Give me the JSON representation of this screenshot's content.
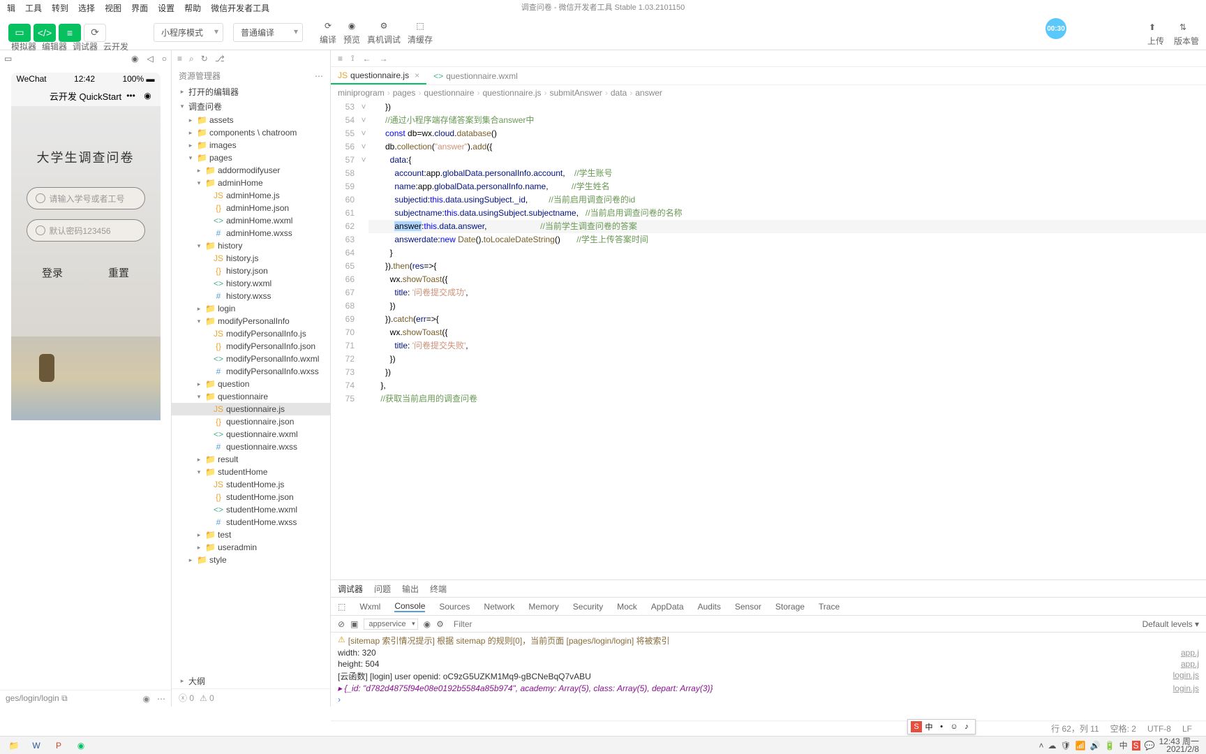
{
  "menubar": [
    "辑",
    "工具",
    "转到",
    "选择",
    "视图",
    "界面",
    "设置",
    "帮助",
    "微信开发者工具"
  ],
  "titlebar": "调查问卷 - 微信开发者工具 Stable 1.03.2101150",
  "toolbar": {
    "group_labels": [
      "模拟器",
      "编辑器",
      "调试器",
      "云开发"
    ],
    "select1": "小程序模式",
    "select2": "普通编译",
    "actions": [
      "编译",
      "预览",
      "真机调试",
      "清缓存"
    ],
    "timer": "00:30",
    "right": [
      "上传",
      "版本管"
    ]
  },
  "simulator": {
    "status": {
      "left": "WeChat",
      "center": "12:42",
      "right": "100%"
    },
    "header_title": "云开发 QuickStart",
    "survey_title": "大学生调查问卷",
    "input1": "请输入学号或者工号",
    "input2": "默认密码123456",
    "btn_login": "登录",
    "btn_reset": "重置",
    "footer_path": "ges/login/login"
  },
  "filetree": {
    "header": "资源管理器",
    "opened_editors": "打开的编辑器",
    "project": "调查问卷",
    "outline": "大纲",
    "items": [
      {
        "l": 2,
        "t": "folder",
        "n": "assets"
      },
      {
        "l": 2,
        "t": "folder",
        "n": "components \\ chatroom"
      },
      {
        "l": 2,
        "t": "folder",
        "n": "images"
      },
      {
        "l": 2,
        "t": "folder",
        "n": "pages",
        "open": true
      },
      {
        "l": 3,
        "t": "folder",
        "n": "addormodifyuser"
      },
      {
        "l": 3,
        "t": "folder",
        "n": "adminHome",
        "open": true
      },
      {
        "l": 4,
        "t": "js",
        "n": "adminHome.js"
      },
      {
        "l": 4,
        "t": "json",
        "n": "adminHome.json"
      },
      {
        "l": 4,
        "t": "wxml",
        "n": "adminHome.wxml"
      },
      {
        "l": 4,
        "t": "wxss",
        "n": "adminHome.wxss"
      },
      {
        "l": 3,
        "t": "folder",
        "n": "history",
        "open": true
      },
      {
        "l": 4,
        "t": "js",
        "n": "history.js"
      },
      {
        "l": 4,
        "t": "json",
        "n": "history.json"
      },
      {
        "l": 4,
        "t": "wxml",
        "n": "history.wxml"
      },
      {
        "l": 4,
        "t": "wxss",
        "n": "history.wxss"
      },
      {
        "l": 3,
        "t": "folder",
        "n": "login"
      },
      {
        "l": 3,
        "t": "folder",
        "n": "modifyPersonalInfo",
        "open": true
      },
      {
        "l": 4,
        "t": "js",
        "n": "modifyPersonalInfo.js"
      },
      {
        "l": 4,
        "t": "json",
        "n": "modifyPersonalInfo.json"
      },
      {
        "l": 4,
        "t": "wxml",
        "n": "modifyPersonalInfo.wxml"
      },
      {
        "l": 4,
        "t": "wxss",
        "n": "modifyPersonalInfo.wxss"
      },
      {
        "l": 3,
        "t": "folder",
        "n": "question"
      },
      {
        "l": 3,
        "t": "folder",
        "n": "questionnaire",
        "open": true,
        "sel": false
      },
      {
        "l": 4,
        "t": "js",
        "n": "questionnaire.js",
        "sel": true
      },
      {
        "l": 4,
        "t": "json",
        "n": "questionnaire.json"
      },
      {
        "l": 4,
        "t": "wxml",
        "n": "questionnaire.wxml"
      },
      {
        "l": 4,
        "t": "wxss",
        "n": "questionnaire.wxss"
      },
      {
        "l": 3,
        "t": "folder",
        "n": "result"
      },
      {
        "l": 3,
        "t": "folder",
        "n": "studentHome",
        "open": true
      },
      {
        "l": 4,
        "t": "js",
        "n": "studentHome.js"
      },
      {
        "l": 4,
        "t": "json",
        "n": "studentHome.json"
      },
      {
        "l": 4,
        "t": "wxml",
        "n": "studentHome.wxml"
      },
      {
        "l": 4,
        "t": "wxss",
        "n": "studentHome.wxss"
      },
      {
        "l": 3,
        "t": "folder",
        "n": "test"
      },
      {
        "l": 3,
        "t": "folder",
        "n": "useradmin"
      },
      {
        "l": 2,
        "t": "folder",
        "n": "style"
      }
    ],
    "warnings": "0",
    "errors": "0"
  },
  "editor": {
    "tabs": [
      {
        "icon": "js",
        "name": "questionnaire.js",
        "active": true
      },
      {
        "icon": "wxml",
        "name": "questionnaire.wxml",
        "active": false
      }
    ],
    "breadcrumb": [
      "miniprogram",
      "pages",
      "questionnaire",
      "questionnaire.js",
      "submitAnswer",
      "data",
      "answer"
    ],
    "first_line": 53,
    "lines": [
      {
        "html": "      })"
      },
      {
        "html": "      <span class='c-com'>//通过小程序端存储答案到集合answer中</span>"
      },
      {
        "html": "      <span class='c-kw'>const</span> db=wx.<span class='c-prop'>cloud</span>.<span class='c-fn'>database</span>()"
      },
      {
        "html": "      db.<span class='c-fn'>collection</span>(<span class='c-str'>\"answer\"</span>).<span class='c-fn'>add</span>({",
        "fold": "˅"
      },
      {
        "html": "        <span class='c-prop'>data</span>:{",
        "fold": "˅"
      },
      {
        "html": "          <span class='c-prop'>account</span>:app.<span class='c-prop'>globalData</span>.<span class='c-prop'>personalInfo</span>.<span class='c-prop'>account</span>,    <span class='c-com'>//学生账号</span>"
      },
      {
        "html": "          <span class='c-prop'>name</span>:app.<span class='c-prop'>globalData</span>.<span class='c-prop'>personalInfo</span>.<span class='c-prop'>name</span>,          <span class='c-com'>//学生姓名</span>"
      },
      {
        "html": "          <span class='c-prop'>subjectid</span>:<span class='c-this'>this</span>.<span class='c-prop'>data</span>.<span class='c-prop'>usingSubject</span>.<span class='c-prop'>_id</span>,         <span class='c-com'>//当前启用调查问卷的id</span>"
      },
      {
        "html": "          <span class='c-prop'>subjectname</span>:<span class='c-this'>this</span>.<span class='c-prop'>data</span>.<span class='c-prop'>usingSubject</span>.<span class='c-prop'>subjectname</span>,   <span class='c-com'>//当前启用调查问卷的名称</span>"
      },
      {
        "html": "          <span class='c-sel'>answer</span>:<span class='c-this'>this</span>.<span class='c-prop'>data</span>.<span class='c-prop'>answer</span>,                       <span class='c-com'>//当前学生调查问卷的答案</span>",
        "hl": true
      },
      {
        "html": "          <span class='c-prop'>answerdate</span>:<span class='c-kw'>new</span> <span class='c-fn'>Date</span>().<span class='c-fn'>toLocaleDateString</span>()       <span class='c-com'>//学生上传答案时间</span>"
      },
      {
        "html": "        }"
      },
      {
        "html": "      }).<span class='c-fn'>then</span>(<span class='c-prop'>res</span>=&gt;{",
        "fold": "˅"
      },
      {
        "html": "        wx.<span class='c-fn'>showToast</span>({",
        "fold": "˅"
      },
      {
        "html": "          <span class='c-prop'>title</span>: <span class='c-str'>'问卷提交成功'</span>,"
      },
      {
        "html": "        })"
      },
      {
        "html": "      }).<span class='c-fn'>catch</span>(<span class='c-prop'>err</span>=&gt;{"
      },
      {
        "html": "        wx.<span class='c-fn'>showToast</span>({",
        "fold": "˅"
      },
      {
        "html": "          <span class='c-prop'>title</span>: <span class='c-str'>'问卷提交失败'</span>,"
      },
      {
        "html": "        })"
      },
      {
        "html": "      })"
      },
      {
        "html": "    },"
      },
      {
        "html": "    <span class='c-com'>//获取当前启用的调查问卷</span>"
      }
    ]
  },
  "debug": {
    "upper_tabs": [
      "调试器",
      "问题",
      "输出",
      "终端"
    ],
    "devtools": [
      "Wxml",
      "Console",
      "Sources",
      "Network",
      "Memory",
      "Security",
      "Mock",
      "AppData",
      "Audits",
      "Sensor",
      "Storage",
      "Trace"
    ],
    "devtools_active": "Console",
    "context": "appservice",
    "filter_placeholder": "Filter",
    "levels": "Default levels ▾",
    "console": [
      {
        "warn": true,
        "text": "[sitemap 索引情况提示] 根据 sitemap 的规则[0]，当前页面 [pages/login/login] 将被索引"
      },
      {
        "text": "width: 320",
        "link": "app.j"
      },
      {
        "text": "height: 504",
        "link": "app.j"
      },
      {
        "text": "[云函数] [login] user openid:  oC9zG5UZKM1Mq9-gBCNeBqQ7vABU",
        "link": "login.js"
      },
      {
        "obj": true,
        "text": "▸ {_id: \"d782d4875f94e08e0192b5584a85b974\", academy: Array(5), class: Array(5), depart: Array(3)}",
        "link": "login.js"
      }
    ]
  },
  "statusline": {
    "pos": "行 62，列 11",
    "spaces": "空格: 2",
    "enc": "UTF-8",
    "eol": "LF"
  },
  "taskbar": {
    "clock_time": "12:43 周一",
    "clock_date": "2021/2/8"
  }
}
